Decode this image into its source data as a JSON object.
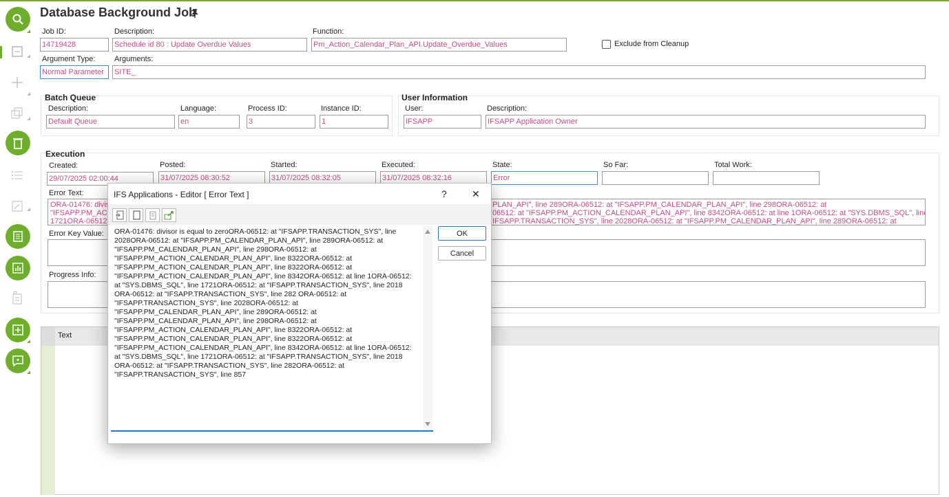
{
  "window": {
    "title": "Database Background Job"
  },
  "header": {
    "job_id_label": "Job ID:",
    "job_id": "14719428",
    "description_label": "Description:",
    "description": "Schedule id 80 : Update Overdue Values",
    "function_label": "Function:",
    "function": "Pm_Action_Calendar_Plan_API.Update_Overdue_Values",
    "exclude_label": "Exclude from Cleanup",
    "argument_type_label": "Argument Type:",
    "argument_type": "Normal Parameter",
    "arguments_label": "Arguments:",
    "arguments": "SITE_"
  },
  "batch_queue": {
    "title": "Batch Queue",
    "description_label": "Description:",
    "description": "Default Queue",
    "language_label": "Language:",
    "language": "en",
    "process_id_label": "Process ID:",
    "process_id": "3",
    "instance_id_label": "Instance ID:",
    "instance_id": "1"
  },
  "user_info": {
    "title": "User Information",
    "user_label": "User:",
    "user": "IFSAPP",
    "description_label": "Description:",
    "description": "IFSAPP Application Owner"
  },
  "execution": {
    "title": "Execution",
    "created_label": "Created:",
    "created": "29/07/2025 02:00:44",
    "posted_label": "Posted:",
    "posted": "31/07/2025 08:30:52",
    "started_label": "Started:",
    "started": "31/07/2025 08:32:05",
    "executed_label": "Executed:",
    "executed": "31/07/2025 08:32:16",
    "state_label": "State:",
    "state": "Error",
    "so_far_label": "So Far:",
    "so_far": "",
    "total_work_label": "Total Work:",
    "total_work": "",
    "error_text_label": "Error Text:",
    "error_text_visible_left": "ORA-01476: divis\n\"IFSAPP.PM_ACT\n1721ORA-06512",
    "error_text_visible_right": "PLAN_API\", line 289ORA-06512: at \"IFSAPP.PM_CALENDAR_PLAN_API\", line 298ORA-06512: at\n06512: at \"IFSAPP.PM_ACTION_CALENDAR_PLAN_API\", line 8342ORA-06512: at line 1ORA-06512: at \"SYS.DBMS_SQL\", line\nIFSAPP.TRANSACTION_SYS\", line 2028ORA-06512: at \"IFSAPP.PM_CALENDAR_PLAN_API\", line 289ORA-06512: at",
    "error_key_label": "Error Key Value:",
    "error_key": "",
    "progress_label": "Progress Info:",
    "progress": ""
  },
  "grid": {
    "column_text": "Text"
  },
  "dialog": {
    "title": "IFS Applications - Editor [ Error Text ]",
    "help": "?",
    "close": "✕",
    "ok_label": "OK",
    "cancel_label": "Cancel",
    "content": "ORA-01476: divisor is equal to zeroORA-06512: at \"IFSAPP.TRANSACTION_SYS\", line 2028ORA-06512: at \"IFSAPP.PM_CALENDAR_PLAN_API\", line 289ORA-06512: at \"IFSAPP.PM_CALENDAR_PLAN_API\", line 298ORA-06512: at \"IFSAPP.PM_ACTION_CALENDAR_PLAN_API\", line 8322ORA-06512: at \"IFSAPP.PM_ACTION_CALENDAR_PLAN_API\", line 8322ORA-06512: at \"IFSAPP.PM_ACTION_CALENDAR_PLAN_API\", line 8342ORA-06512: at line 1ORA-06512: at \"SYS.DBMS_SQL\", line 1721ORA-06512: at \"IFSAPP.TRANSACTION_SYS\", line 2018 ORA-06512: at \"IFSAPP.TRANSACTION_SYS\", line 282 ORA-06512: at \"IFSAPP.TRANSACTION_SYS\", line 2028ORA-06512: at \"IFSAPP.PM_CALENDAR_PLAN_API\", line 289ORA-06512: at \"IFSAPP.PM_CALENDAR_PLAN_API\", line 298ORA-06512: at \"IFSAPP.PM_ACTION_CALENDAR_PLAN_API\", line 8322ORA-06512: at \"IFSAPP.PM_ACTION_CALENDAR_PLAN_API\", line 8322ORA-06512: at \"IFSAPP.PM_ACTION_CALENDAR_PLAN_API\", line 8342ORA-06512: at line 1ORA-06512: at \"SYS.DBMS_SQL\", line 1721ORA-06512: at \"IFSAPP.TRANSACTION_SYS\", line 2018 ORA-06512: at \"IFSAPP.TRANSACTION_SYS\", line 282ORA-06512: at \"IFSAPP.TRANSACTION_SYS\", line 857"
  },
  "sidebar_icons": [
    "search-icon",
    "form-icon",
    "add-icon",
    "duplicate-icon",
    "delete-icon",
    "list-icon",
    "shortcut-icon",
    "details-icon",
    "chart-icon",
    "report-icon",
    "new-note-icon",
    "comment-icon"
  ],
  "colors": {
    "accent": "#6fae2c",
    "value_text": "#c04a8a",
    "focus_border": "#2a74c0"
  }
}
